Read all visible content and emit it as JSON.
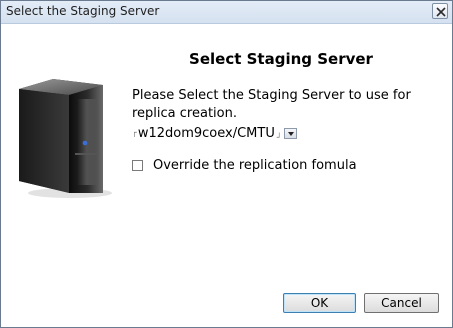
{
  "window": {
    "title": "Select the Staging Server"
  },
  "dialog": {
    "heading": "Select Staging Server",
    "prompt": "Please Select the Staging Server to use for replica creation.",
    "server_select": {
      "selected_value": "w12dom9coex/CMTU"
    },
    "override_checkbox": {
      "label": "Override the replication fomula",
      "checked": false
    }
  },
  "buttons": {
    "ok_label": "OK",
    "cancel_label": "Cancel"
  },
  "icons": {
    "close": "close-icon",
    "server": "server-tower-icon",
    "dropdown": "chevron-down-icon"
  },
  "colors": {
    "titlebar": "#dce6f3",
    "background": "#ffffff",
    "default_button_border": "#3c7fb1"
  }
}
